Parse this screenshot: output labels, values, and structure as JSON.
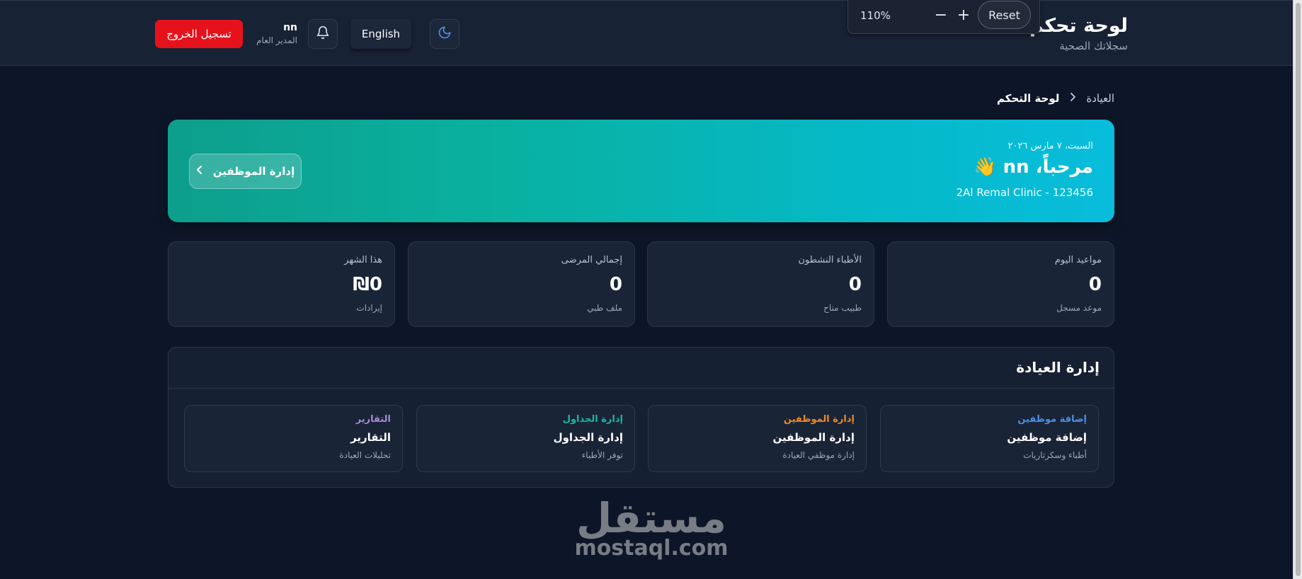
{
  "header": {
    "app_title": "لوحة تحكم",
    "app_subtitle": "سجلاتك الصحية",
    "logout_label": "تسجيل الخروج",
    "user_name": "nn",
    "user_role": "المدير العام",
    "language_label": "English"
  },
  "zoom_popup": {
    "level": "110%",
    "minus": "−",
    "plus": "+",
    "reset_label": "Reset"
  },
  "breadcrumb": {
    "home": "العيادة",
    "separator": "›",
    "current": "لوحة التحكم"
  },
  "hero": {
    "date": "السبت، ٧ مارس ٢٠٢٦",
    "greeting": "مرحباً، nn 👋",
    "clinic": "2Al Remal Clinic - 123456",
    "button_label": "إدارة الموظفين"
  },
  "stats": [
    {
      "label": "مواعيد اليوم",
      "value": "0",
      "sub": "موعد مسجل"
    },
    {
      "label": "الأطباء النشطون",
      "value": "0",
      "sub": "طبيب متاح"
    },
    {
      "label": "إجمالي المرضى",
      "value": "0",
      "sub": "ملف طبي"
    },
    {
      "label": "هذا الشهر",
      "value": "₪0",
      "sub": "إيرادات"
    }
  ],
  "management": {
    "title": "إدارة العيادة",
    "actions": [
      {
        "tag": "إضافة موظفين",
        "title": "إضافة موظفين",
        "desc": "أطباء وسكرتاريات",
        "color": "#4a90e2"
      },
      {
        "tag": "إدارة الموظفين",
        "title": "إدارة الموظفين",
        "desc": "إدارة موظفي العيادة",
        "color": "#f08a24"
      },
      {
        "tag": "إدارة الجداول",
        "title": "إدارة الجداول",
        "desc": "توفر الأطباء",
        "color": "#19b9a6"
      },
      {
        "tag": "التقارير",
        "title": "التقارير",
        "desc": "تحليلات العيادة",
        "color": "#a58bd6"
      }
    ]
  },
  "watermark": {
    "arabic": "مستقل",
    "latin": "mostaql.com"
  },
  "colors": {
    "background": "#0d1628",
    "header": "#182235",
    "card": "#1a2437",
    "logout": "#e5121c",
    "hero_start": "#0d9e8c",
    "hero_end": "#08bddc",
    "moon_icon": "#4b8fe8"
  }
}
